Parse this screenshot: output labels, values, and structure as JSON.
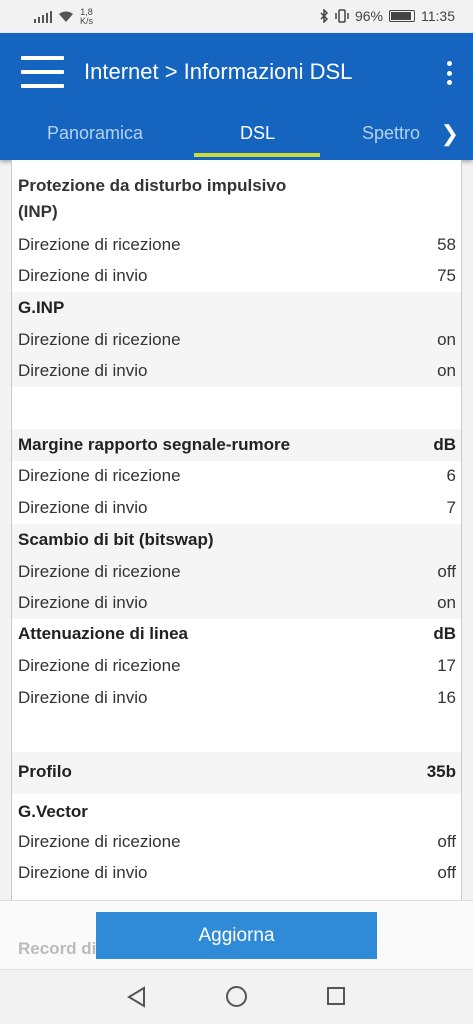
{
  "status_bar": {
    "net_speed_value": "1,8",
    "net_speed_unit": "K/s",
    "battery_percent": "96%",
    "battery_level": 0.96,
    "time": "11:35"
  },
  "appbar": {
    "title": "Internet > Informazioni DSL"
  },
  "tabs": [
    {
      "label": "Panoramica"
    },
    {
      "label": "DSL"
    },
    {
      "label": "Spettro"
    }
  ],
  "rows": [
    {
      "label": "Protezione da disturbo impulsivo",
      "value": ""
    },
    {
      "label": "(INP)",
      "value": ""
    },
    {
      "label": "Direzione di ricezione",
      "value": "58"
    },
    {
      "label": "Direzione di invio",
      "value": "75"
    },
    {
      "label": "G.INP",
      "value": ""
    },
    {
      "label": "Direzione di ricezione",
      "value": "on"
    },
    {
      "label": "Direzione di invio",
      "value": "on"
    },
    {
      "label": "Margine rapporto segnale-rumore",
      "value": "dB"
    },
    {
      "label": "Direzione di ricezione",
      "value": "6"
    },
    {
      "label": "Direzione di invio",
      "value": "7"
    },
    {
      "label": "Scambio di bit (bitswap)",
      "value": ""
    },
    {
      "label": "Direzione di ricezione",
      "value": "off"
    },
    {
      "label": "Direzione di invio",
      "value": "on"
    },
    {
      "label": "Attenuazione di linea",
      "value": "dB"
    },
    {
      "label": "Direzione di ricezione",
      "value": "17"
    },
    {
      "label": "Direzione di invio",
      "value": "16"
    },
    {
      "label": "Profilo",
      "value": "35b"
    },
    {
      "label": "G.Vector",
      "value": ""
    },
    {
      "label": "Direzione di ricezione",
      "value": "off"
    },
    {
      "label": "Direzione di invio",
      "value": "off"
    }
  ],
  "footer": {
    "ghost_text": "Record di",
    "update_button": "Aggiorna"
  }
}
